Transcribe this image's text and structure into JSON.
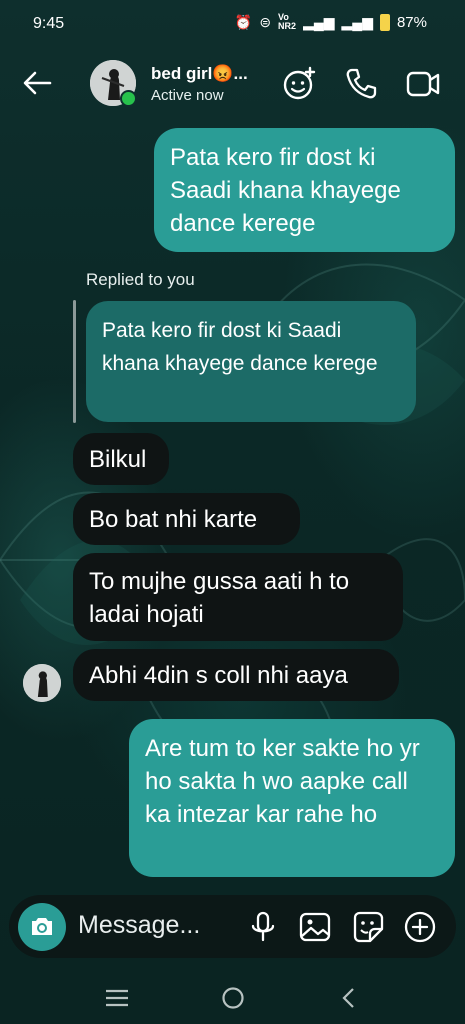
{
  "status_bar": {
    "time": "9:45",
    "network": "Vo\nNR2",
    "battery": "87%"
  },
  "header": {
    "name": "bed girl😡...",
    "status": "Active now"
  },
  "messages": {
    "m1": "Pata kero fir dost ki Saadi khana khayege dance kerege",
    "replied_label": "Replied to you",
    "quoted": "Pata kero fir dost ki Saadi khana khayege dance kerege",
    "m2": "Bilkul",
    "m3": "Bo bat nhi karte",
    "m4": "To mujhe gussa aati h to ladai hojati",
    "m5": "Abhi 4din s coll nhi aaya",
    "m6": "Are tum to ker sakte ho yr ho sakta h wo aapke call ka intezar kar rahe ho"
  },
  "composer": {
    "placeholder": "Message..."
  },
  "colors": {
    "outgoing": "#2a9d96",
    "incoming": "#0f1414",
    "quoted": "#1c6b67",
    "online": "#27c24c"
  },
  "icons": [
    "back-arrow-icon",
    "effects-icon",
    "phone-icon",
    "video-icon",
    "camera-icon",
    "microphone-icon",
    "gallery-icon",
    "sticker-icon",
    "plus-icon",
    "menu-icon",
    "home-icon",
    "back-icon"
  ]
}
